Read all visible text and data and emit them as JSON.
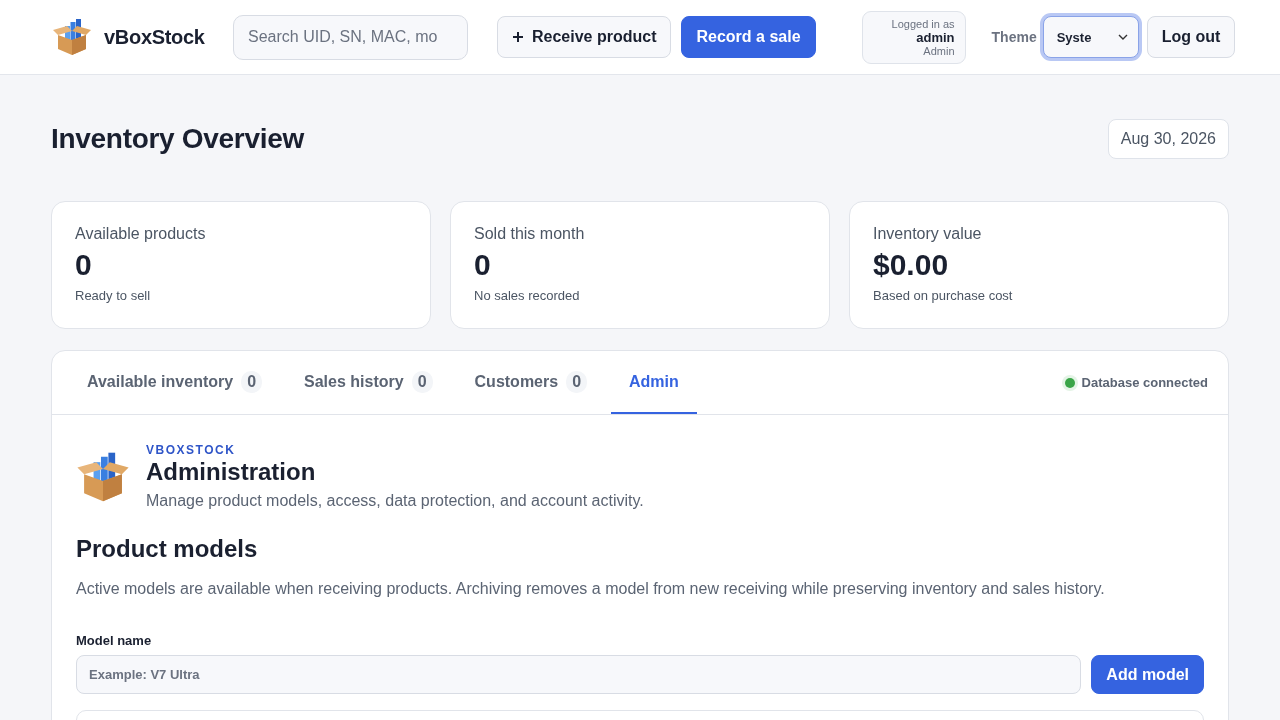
{
  "app": {
    "name": "vBoxStock"
  },
  "search": {
    "placeholder": "Search UID, SN, MAC, mo"
  },
  "actions": [
    {
      "label": "Receive product",
      "kind": "secondary"
    },
    {
      "label": "Record a sale",
      "kind": "primary"
    }
  ],
  "user": {
    "caption": "Logged in as",
    "name": "admin",
    "role": "Admin"
  },
  "theme": {
    "label": "Theme",
    "value": "Syste",
    "focused": true
  },
  "logout": "Log out",
  "page": {
    "title": "Inventory Overview",
    "date": "Aug 30, 2026"
  },
  "stats": [
    {
      "label": "Available products",
      "value": "0",
      "note": "Ready to sell"
    },
    {
      "label": "Sold this month",
      "value": "0",
      "note": "No sales recorded"
    },
    {
      "label": "Inventory value",
      "value": "$0.00",
      "note": "Based on purchase cost"
    }
  ],
  "tabs": [
    {
      "label": "Available inventory",
      "count": "0",
      "selected": false
    },
    {
      "label": "Sales history",
      "count": "0",
      "selected": false
    },
    {
      "label": "Customers",
      "count": "0",
      "selected": false
    },
    {
      "label": "Admin",
      "selected": true
    }
  ],
  "status": {
    "text": "Database connected",
    "color": "#3aa548"
  },
  "admin": {
    "eyebrow": "VBOXSTOCK",
    "title": "Administration",
    "subtitle": "Manage product models, access, data protection, and account activity."
  },
  "models": {
    "title": "Product models",
    "description": "Active models are available when receiving products. Archiving removes a model from new receiving while preserving inventory and sales history.",
    "field_label": "Model name",
    "placeholder": "Example: V7 Ultra",
    "button": "Add model"
  }
}
